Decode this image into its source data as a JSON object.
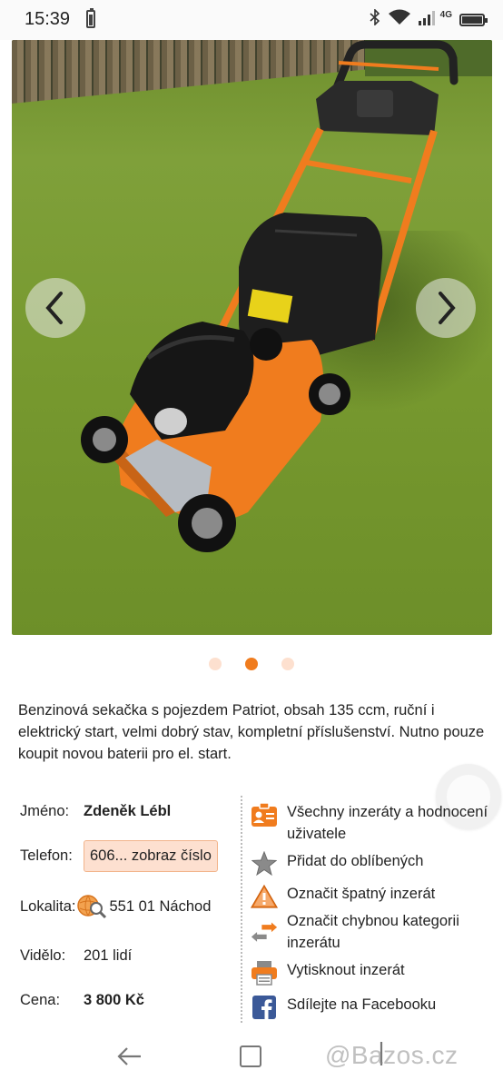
{
  "status_bar": {
    "time": "15:39",
    "network": "4G"
  },
  "gallery": {
    "prev_icon": "chevron-left-icon",
    "next_icon": "chevron-right-icon",
    "total_images": 3,
    "active_index": 2
  },
  "description": "Benzinová sekačka s pojezdem Patriot, obsah 135 ccm, ruční i elektrický start, velmi dobrý stav, kompletní příslušenství. Nutno pouze koupit novou baterii pro el. start.",
  "seller": {
    "name_label": "Jméno:",
    "name_value": "Zdeněk Lébl",
    "phone_label": "Telefon:",
    "phone_value": "606... zobraz číslo",
    "location_label": "Lokalita:",
    "location_value": "551 01 Náchod",
    "views_label": "Vidělo:",
    "views_value": "201 lidí",
    "price_label": "Cena:",
    "price_value": "3 800 Kč"
  },
  "actions": {
    "all_ads": "Všechny inzeráty a hodnocení uživatele",
    "favorite": "Přidat do oblíbených",
    "report": "Označit špatný inzerát",
    "wrong_category": "Označit chybnou kategorii inzerátu",
    "print": "Vytisknout inzerát",
    "facebook": "Sdílejte na Facebooku"
  },
  "watermark": "@Bazos.cz",
  "colors": {
    "accent": "#f07c1e",
    "dot_inactive": "#fde0cf",
    "phone_bg": "#fde0d0",
    "facebook": "#3b5998"
  }
}
